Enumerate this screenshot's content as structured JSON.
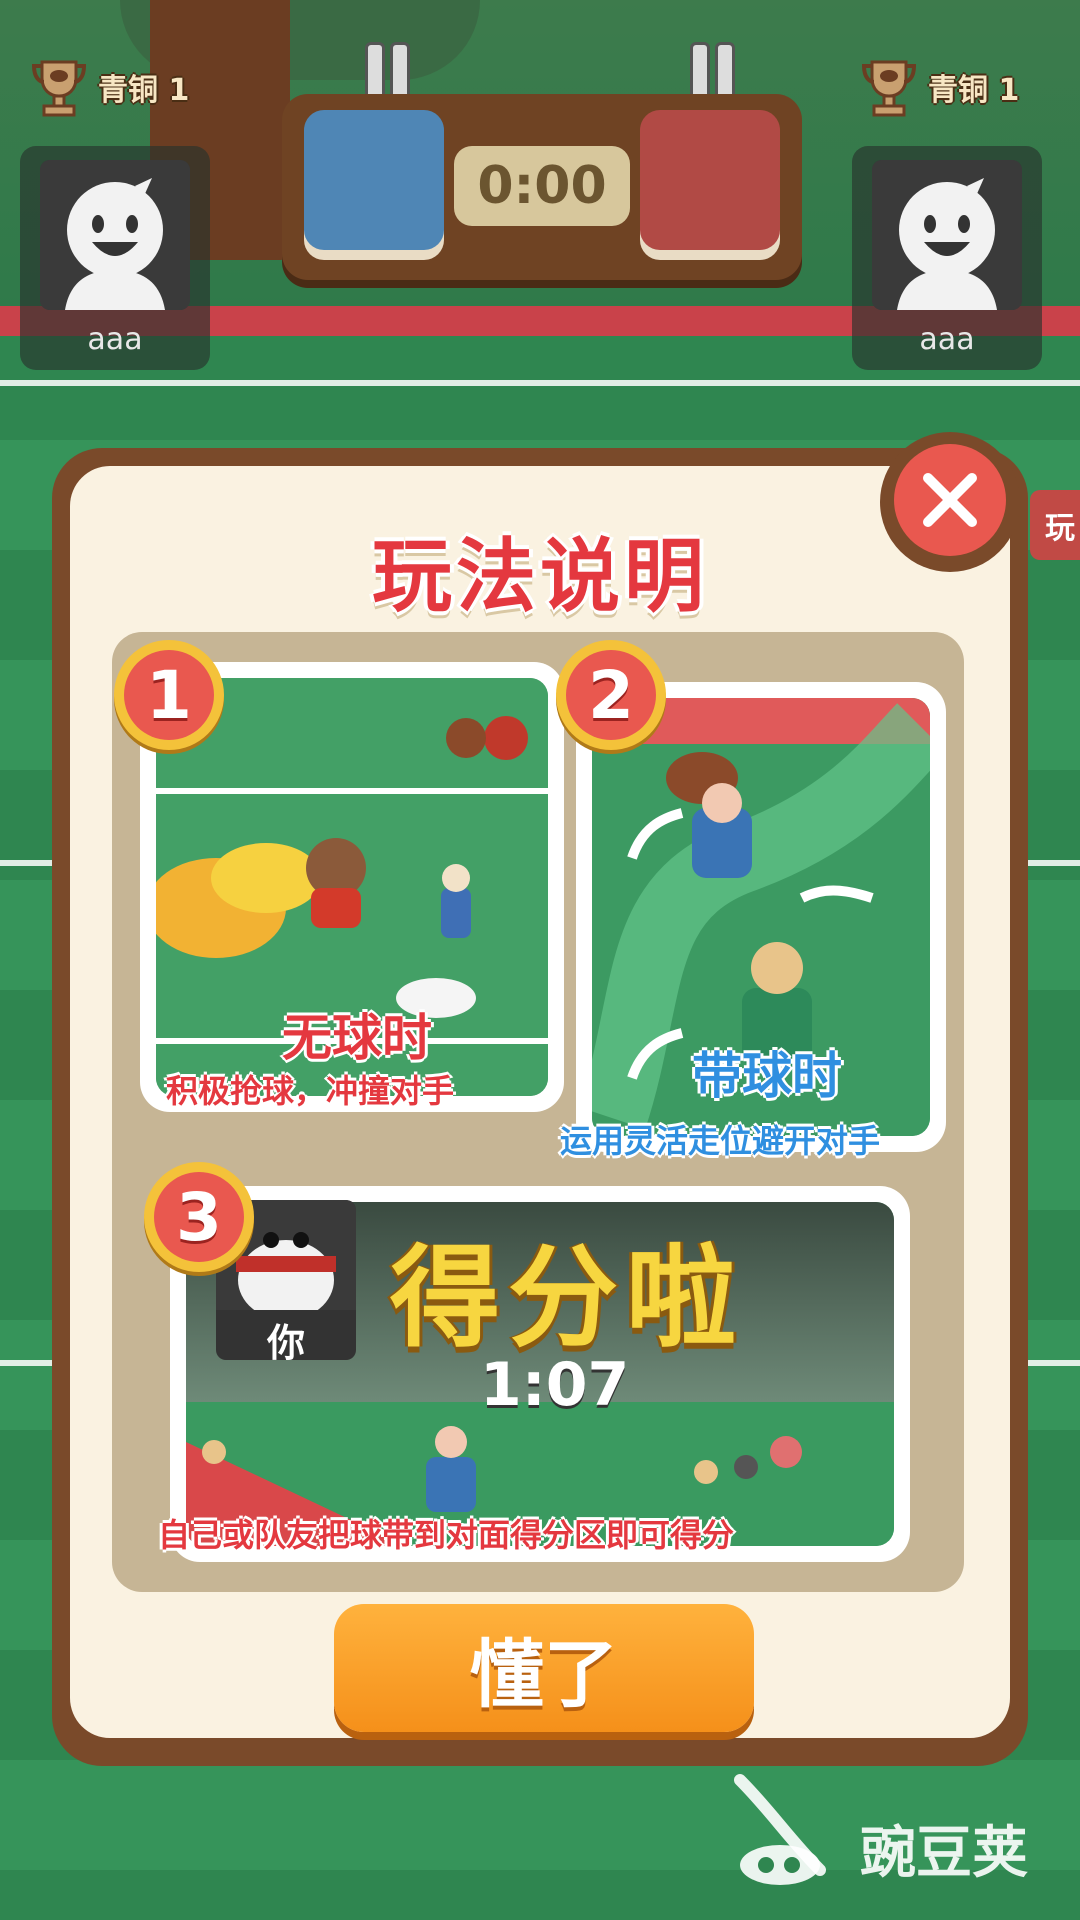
{
  "hud": {
    "left_rank": "青铜 1",
    "right_rank": "青铜 1",
    "left_player": "aaa",
    "right_player": "aaa",
    "timer": "0:00"
  },
  "side_tab_label": "玩",
  "modal": {
    "title": "玩法说明",
    "steps": [
      {
        "number": "1",
        "title": "无球时",
        "desc": "积极抢球，冲撞对手"
      },
      {
        "number": "2",
        "title": "带球时",
        "desc": "运用灵活走位避开对手"
      },
      {
        "number": "3",
        "headline": "得分啦",
        "time": "1:07",
        "you_label": "你",
        "desc": "自己或队友把球带到对面得分区即可得分"
      }
    ],
    "confirm_label": "懂了"
  },
  "watermark": "豌豆荚",
  "colors": {
    "accent_red": "#e4383f",
    "accent_blue": "#2f8fe0",
    "button_orange": "#f5901a"
  }
}
